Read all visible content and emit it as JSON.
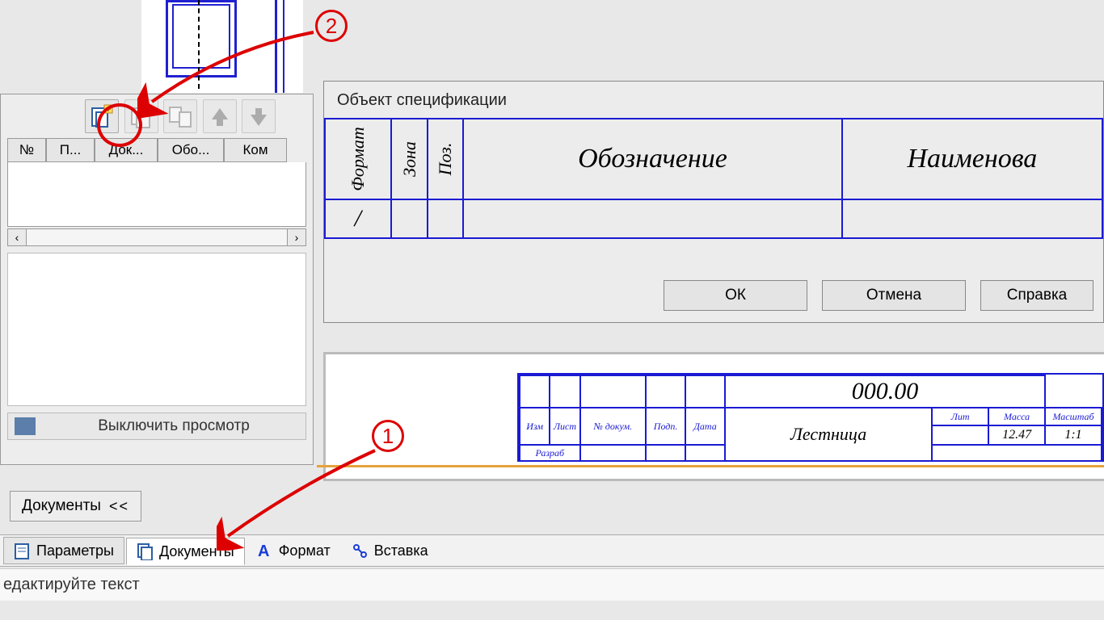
{
  "drawing": {},
  "panel": {
    "columns": [
      "№",
      "П...",
      "Док...",
      "Обо...",
      "Ком"
    ],
    "preview_toggle": "Выключить просмотр"
  },
  "docs_tab": {
    "label": "Документы",
    "chevron": "<<"
  },
  "tabs": {
    "params": "Параметры",
    "docs": "Документы",
    "format": "Формат",
    "insert": "Вставка"
  },
  "status": "едактируйте текст",
  "dialog": {
    "title": "Объект спецификации",
    "cols": {
      "format": "Формат",
      "zone": "Зона",
      "pos": "Поз.",
      "designation": "Обозначение",
      "name": "Наименова"
    },
    "row1_format": "/",
    "ok": "ОК",
    "cancel": "Отмена",
    "help": "Справка"
  },
  "titleblock": {
    "number": "000.00",
    "name": "Лестница",
    "hdr": {
      "izm": "Изм",
      "list": "Лист",
      "ndoc": "№ докум.",
      "podp": "Подп.",
      "date": "Дата",
      "lit": "Лит",
      "mass": "Масса",
      "scale": "Масштаб"
    },
    "razrab": "Разраб",
    "mass_val": "12.47",
    "scale_val": "1:1"
  },
  "annotations": {
    "n1": "1",
    "n2": "2"
  }
}
